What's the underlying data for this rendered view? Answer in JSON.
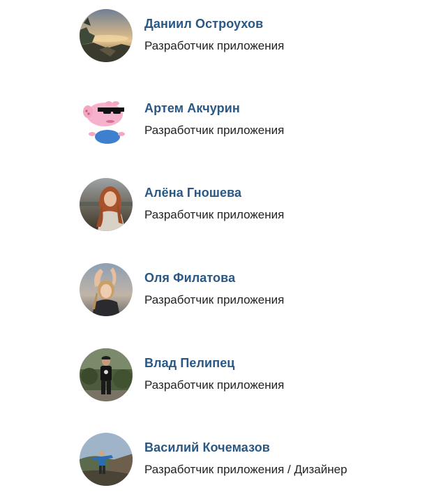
{
  "team": {
    "members": [
      {
        "name": "Даниил Остроухов",
        "role": "Разработчик приложения",
        "avatar": "sunset-landscape-photo"
      },
      {
        "name": "Артем Акчурин",
        "role": "Разработчик приложения",
        "avatar": "cartoon-pig-with-sunglasses"
      },
      {
        "name": "Алёна Гношева",
        "role": "Разработчик приложения",
        "avatar": "woman-portrait-photo"
      },
      {
        "name": "Оля Филатова",
        "role": "Разработчик приложения",
        "avatar": "woman-portrait-photo"
      },
      {
        "name": "Влад Пелипец",
        "role": "Разработчик приложения",
        "avatar": "man-outdoor-photo"
      },
      {
        "name": "Василий Кочемазов",
        "role": "Разработчик приложения / Дизайнер",
        "avatar": "man-outdoor-photo"
      }
    ]
  },
  "colors": {
    "name_link": "#2a5885",
    "role_text": "#222222",
    "background": "#ffffff"
  }
}
